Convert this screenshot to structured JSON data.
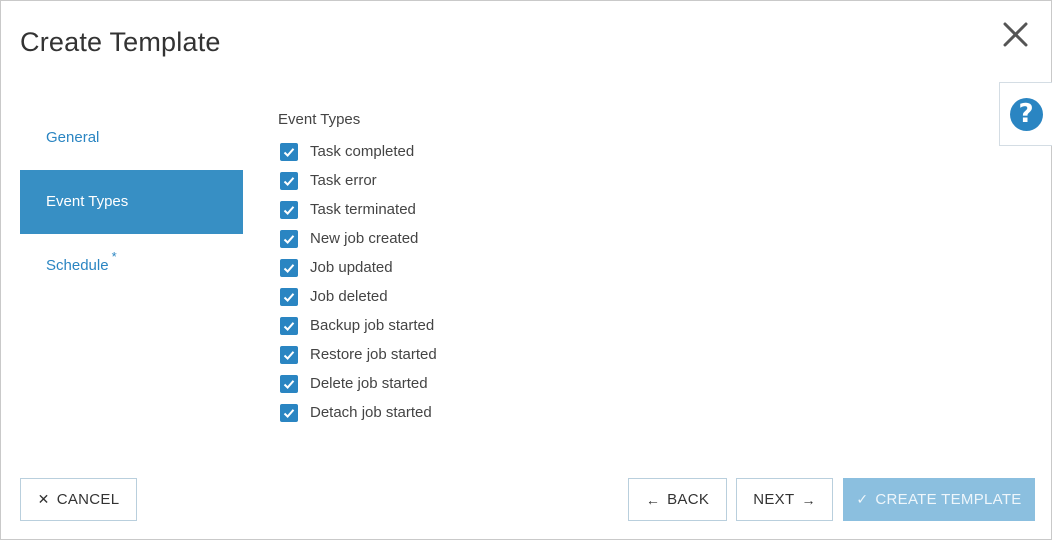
{
  "dialog": {
    "title": "Create Template",
    "close_icon": "close-icon",
    "help_icon": "help-icon",
    "help_glyph": "?"
  },
  "nav": {
    "items": [
      {
        "label": "General",
        "active": false
      },
      {
        "label": "Event Types",
        "active": true
      },
      {
        "label": "Schedule",
        "active": false,
        "required_marker": "*"
      }
    ]
  },
  "event_types": {
    "label": "Event Types",
    "options": [
      {
        "label": "Task completed",
        "checked": true
      },
      {
        "label": "Task error",
        "checked": true
      },
      {
        "label": "Task terminated",
        "checked": true
      },
      {
        "label": "New job created",
        "checked": true
      },
      {
        "label": "Job updated",
        "checked": true
      },
      {
        "label": "Job deleted",
        "checked": true
      },
      {
        "label": "Backup job started",
        "checked": true
      },
      {
        "label": "Restore job started",
        "checked": true
      },
      {
        "label": "Delete job started",
        "checked": true
      },
      {
        "label": "Detach job started",
        "checked": true
      }
    ]
  },
  "footer": {
    "cancel_label": "CANCEL",
    "back_label": "BACK",
    "next_label": "NEXT",
    "create_label": "CREATE TEMPLATE",
    "cancel_glyph": "✕",
    "back_glyph": "←",
    "next_glyph": "→",
    "create_glyph": "✓"
  },
  "colors": {
    "accent": "#2a85c2",
    "active_nav": "#378fc4",
    "disabled_primary": "#8bbfdf"
  }
}
